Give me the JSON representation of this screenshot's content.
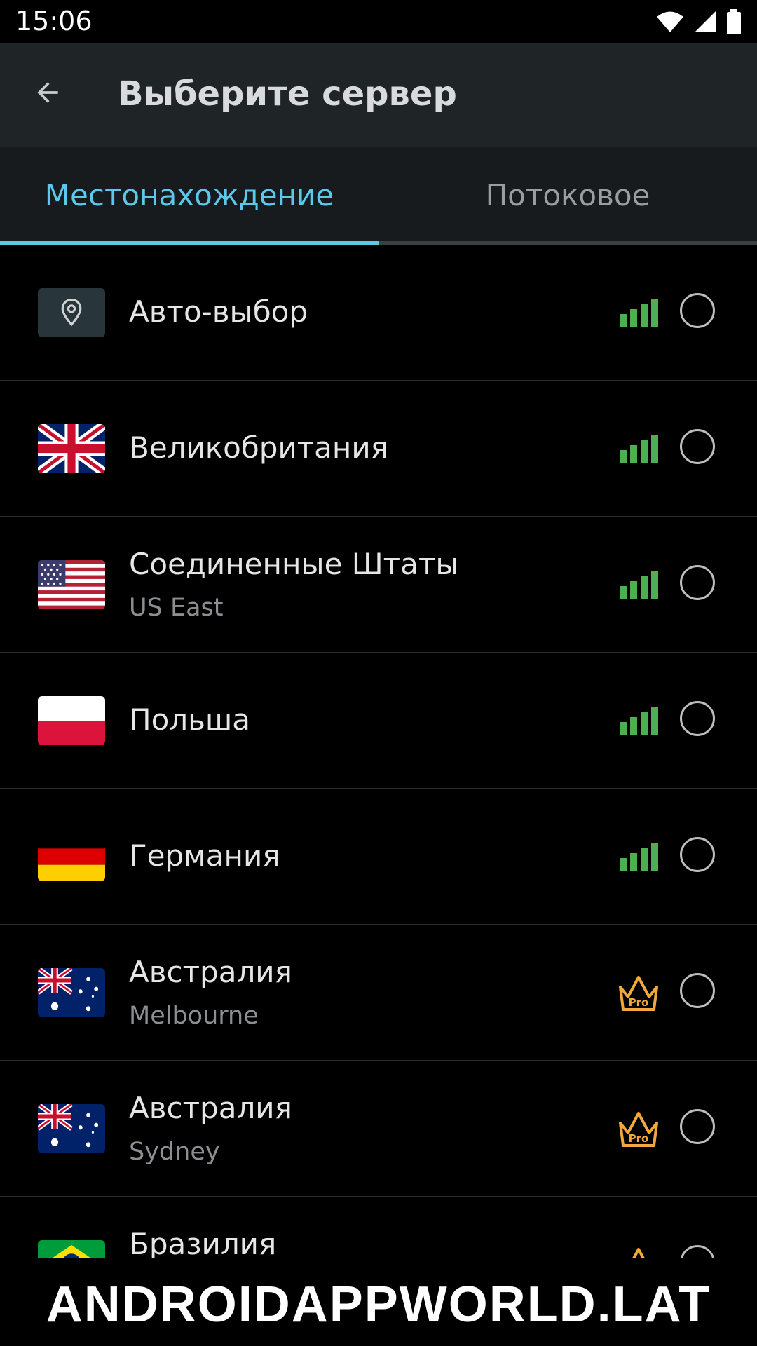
{
  "status_bar": {
    "time": "15:06"
  },
  "app_bar": {
    "title": "Выберите сервер",
    "back_icon": "arrow-back-icon"
  },
  "tabs": [
    {
      "label": "Местонахождение",
      "active": true
    },
    {
      "label": "Потоковое",
      "active": false
    }
  ],
  "colors": {
    "accent": "#5cc8ec",
    "signal": "#4caf50",
    "pro": "#f2a93b",
    "background": "#000000",
    "toolbar": "#1f2427"
  },
  "servers": [
    {
      "name": "Авто-выбор",
      "sub": "",
      "flag": "location-pin-icon",
      "badge": "signal-strength-icon",
      "selected": false
    },
    {
      "name": "Великобритания",
      "sub": "",
      "flag": "uk-flag-icon",
      "badge": "signal-strength-icon",
      "selected": false
    },
    {
      "name": "Соединенные Штаты",
      "sub": "US East",
      "flag": "us-flag-icon",
      "badge": "signal-strength-icon",
      "selected": false
    },
    {
      "name": "Польша",
      "sub": "",
      "flag": "poland-flag-icon",
      "badge": "signal-strength-icon",
      "selected": false
    },
    {
      "name": "Германия",
      "sub": "",
      "flag": "germany-flag-icon",
      "badge": "signal-strength-icon",
      "selected": false
    },
    {
      "name": "Австралия",
      "sub": "Melbourne",
      "flag": "australia-flag-icon",
      "badge": "pro-crown-icon",
      "badge_text": "Pro",
      "selected": false
    },
    {
      "name": "Австралия",
      "sub": "Sydney",
      "flag": "australia-flag-icon",
      "badge": "pro-crown-icon",
      "badge_text": "Pro",
      "selected": false
    },
    {
      "name": "Бразилия",
      "sub": "",
      "flag": "brazil-flag-icon",
      "badge": "pro-crown-icon",
      "selected": false
    }
  ],
  "watermark": "ANDROIDAPPWORLD.LAT"
}
